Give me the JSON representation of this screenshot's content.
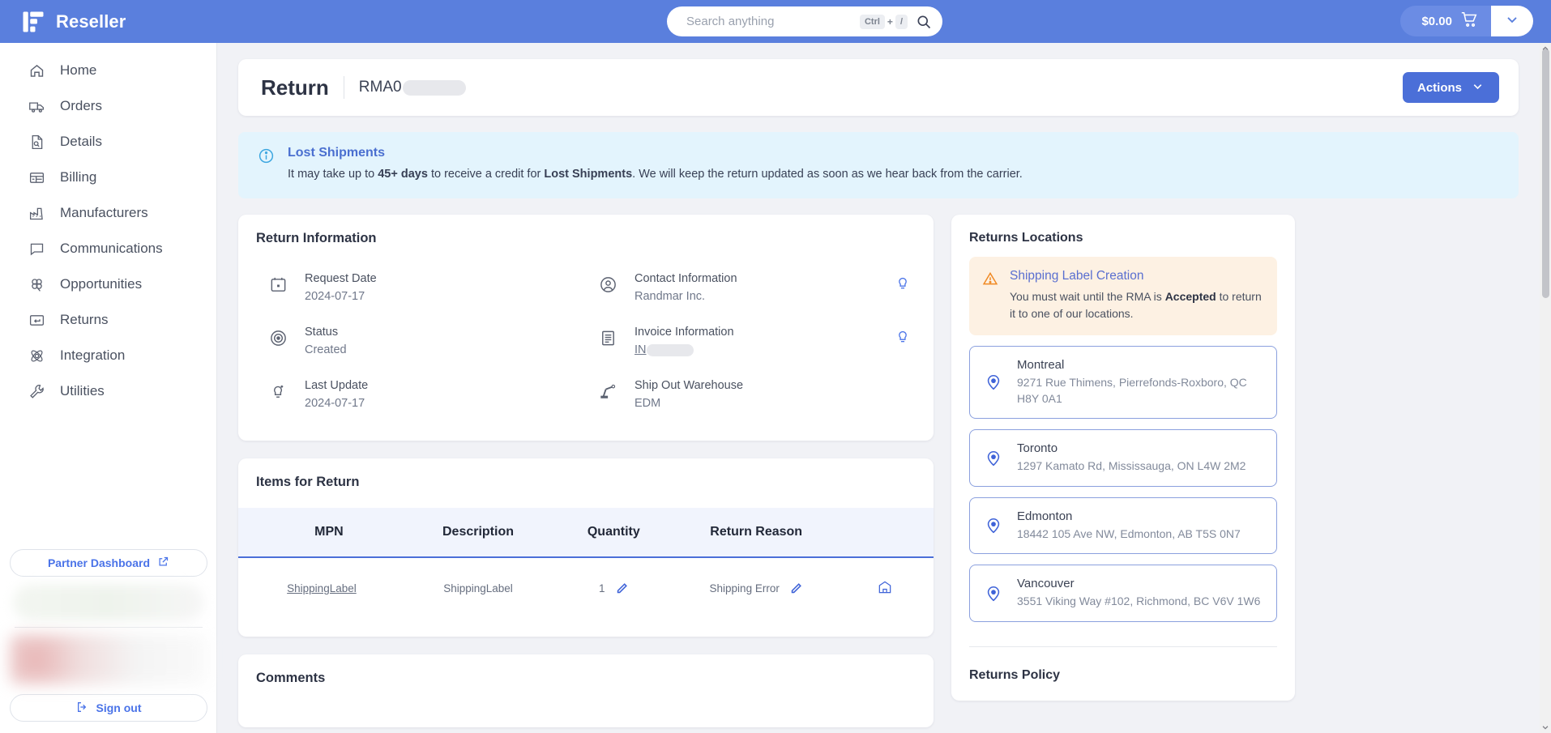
{
  "topbar": {
    "brand": "Reseller",
    "search_placeholder": "Search anything",
    "search_value": "",
    "kbd_ctrl": "Ctrl",
    "kbd_plus": "+",
    "kbd_slash": "/",
    "cart_total": "$0.00"
  },
  "sidebar": {
    "items": [
      {
        "label": "Home",
        "icon": "home-icon"
      },
      {
        "label": "Orders",
        "icon": "truck-icon"
      },
      {
        "label": "Details",
        "icon": "document-search-icon"
      },
      {
        "label": "Billing",
        "icon": "billing-icon"
      },
      {
        "label": "Manufacturers",
        "icon": "factory-icon"
      },
      {
        "label": "Communications",
        "icon": "chat-icon"
      },
      {
        "label": "Opportunities",
        "icon": "clover-icon"
      },
      {
        "label": "Returns",
        "icon": "return-arrow-icon"
      },
      {
        "label": "Integration",
        "icon": "atom-icon"
      },
      {
        "label": "Utilities",
        "icon": "wrench-icon"
      }
    ],
    "partner_dashboard": "Partner Dashboard",
    "sign_out": "Sign out"
  },
  "page": {
    "title": "Return",
    "rma_prefix": "RMA0",
    "actions_label": "Actions"
  },
  "alert": {
    "title": "Lost Shipments",
    "body_1": "It may take up to ",
    "body_bold_1": "45+ days",
    "body_2": " to receive a credit for ",
    "body_bold_2": "Lost Shipments",
    "body_3": ". We will keep the return updated as soon as we hear back from the carrier."
  },
  "return_information": {
    "card_title": "Return Information",
    "fields": [
      {
        "label": "Request Date",
        "value": "2024-07-17",
        "icon": "calendar-icon",
        "has_bulb": false,
        "redacted": false
      },
      {
        "label": "Contact Information",
        "value": "Randmar Inc.",
        "icon": "user-circle-icon",
        "has_bulb": true,
        "redacted": false
      },
      {
        "label": "Status",
        "value": "Created",
        "icon": "target-icon",
        "has_bulb": false,
        "redacted": false
      },
      {
        "label": "Invoice Information",
        "value": "IN",
        "icon": "receipt-icon",
        "has_bulb": true,
        "redacted": true
      },
      {
        "label": "Last Update",
        "value": "2024-07-17",
        "icon": "bulb-plus-icon",
        "has_bulb": false,
        "redacted": false
      },
      {
        "label": "Ship Out Warehouse",
        "value": "EDM",
        "icon": "robot-arm-icon",
        "has_bulb": false,
        "redacted": false
      }
    ]
  },
  "items_for_return": {
    "card_title": "Items for Return",
    "columns": [
      "MPN",
      "Description",
      "Quantity",
      "Return Reason",
      ""
    ],
    "rows": [
      {
        "mpn": "ShippingLabel",
        "description": "ShippingLabel",
        "quantity": "1",
        "return_reason": "Shipping Error"
      }
    ]
  },
  "comments": {
    "card_title": "Comments"
  },
  "returns_locations": {
    "title": "Returns Locations",
    "warning": {
      "title": "Shipping Label Creation",
      "body_1": "You must wait until the RMA is ",
      "body_bold": "Accepted",
      "body_2": " to return it to one of our locations."
    },
    "locations": [
      {
        "city": "Montreal",
        "address": "9271 Rue Thimens, Pierrefonds-Roxboro, QC H8Y 0A1"
      },
      {
        "city": "Toronto",
        "address": "1297 Kamato Rd, Mississauga, ON L4W 2M2"
      },
      {
        "city": "Edmonton",
        "address": "18442 105 Ave NW, Edmonton, AB T5S 0N7"
      },
      {
        "city": "Vancouver",
        "address": "3551 Viking Way #102, Richmond, BC V6V 1W6"
      }
    ],
    "policy_title": "Returns Policy"
  },
  "colors": {
    "brand_blue": "#5a7fdd",
    "accent_blue": "#4b6fd8",
    "info_bg": "#e3f4fd",
    "warn_bg": "#fdf1e3",
    "warn_icon": "#f08a24",
    "page_bg": "#f1f2f6"
  }
}
